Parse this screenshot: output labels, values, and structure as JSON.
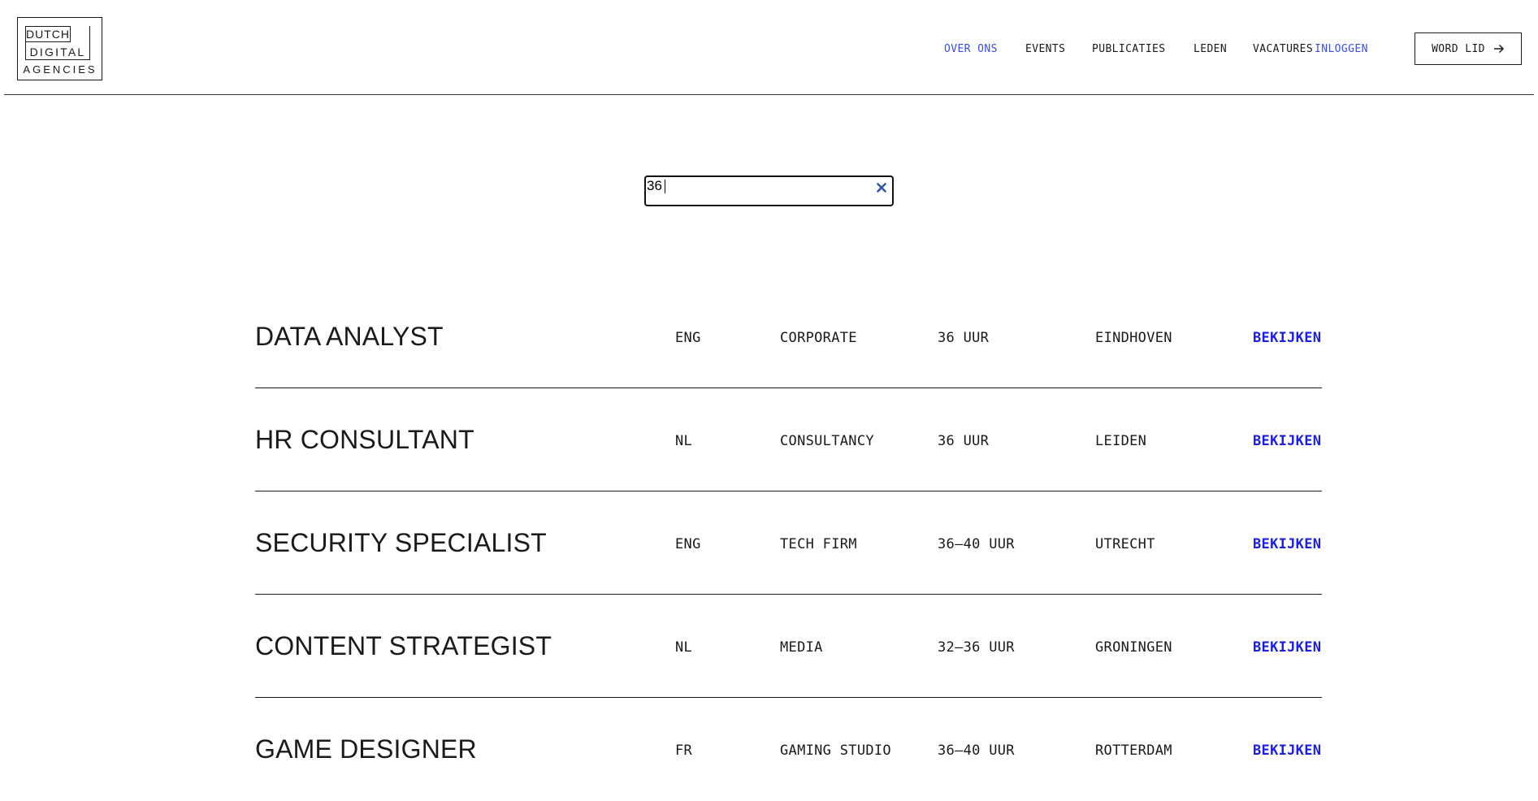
{
  "header": {
    "logo": {
      "line1": "DUTCH",
      "line2": "DIGITAL",
      "line3": "AGENCIES"
    },
    "nav": [
      {
        "label": "OVER ONS",
        "active": true
      },
      {
        "label": "EVENTS",
        "active": false
      },
      {
        "label": "PUBLICATIES",
        "active": false
      },
      {
        "label": "LEDEN",
        "active": false
      },
      {
        "label": "VACATURES",
        "active": false
      },
      {
        "label": "INLOGGEN",
        "active": false
      }
    ],
    "cta": {
      "label": "WORD LID",
      "icon": "arrow-right-icon"
    }
  },
  "search": {
    "value": "36",
    "placeholder": "",
    "clear_icon": "close-icon"
  },
  "jobs": [
    {
      "title": "DATA ANALYST",
      "language": "ENG",
      "type": "CORPORATE",
      "hours": "36 UUR",
      "city": "EINDHOVEN",
      "action": "BEKIJKEN"
    },
    {
      "title": "HR CONSULTANT",
      "language": "NL",
      "type": "CONSULTANCY",
      "hours": "36 UUR",
      "city": "LEIDEN",
      "action": "BEKIJKEN"
    },
    {
      "title": "SECURITY SPECIALIST",
      "language": "ENG",
      "type": "TECH FIRM",
      "hours": "36–40 UUR",
      "city": "UTRECHT",
      "action": "BEKIJKEN"
    },
    {
      "title": "CONTENT STRATEGIST",
      "language": "NL",
      "type": "MEDIA",
      "hours": "32–36 UUR",
      "city": "GRONINGEN",
      "action": "BEKIJKEN"
    },
    {
      "title": "GAME DESIGNER",
      "language": "FR",
      "type": "GAMING STUDIO",
      "hours": "36–40 UUR",
      "city": "ROTTERDAM",
      "action": "BEKIJKEN"
    }
  ],
  "colors": {
    "accent": "#3a4cf2",
    "link": "#1a1ee6",
    "text": "#1a1a1a",
    "clear_icon": "#2f55a8"
  }
}
